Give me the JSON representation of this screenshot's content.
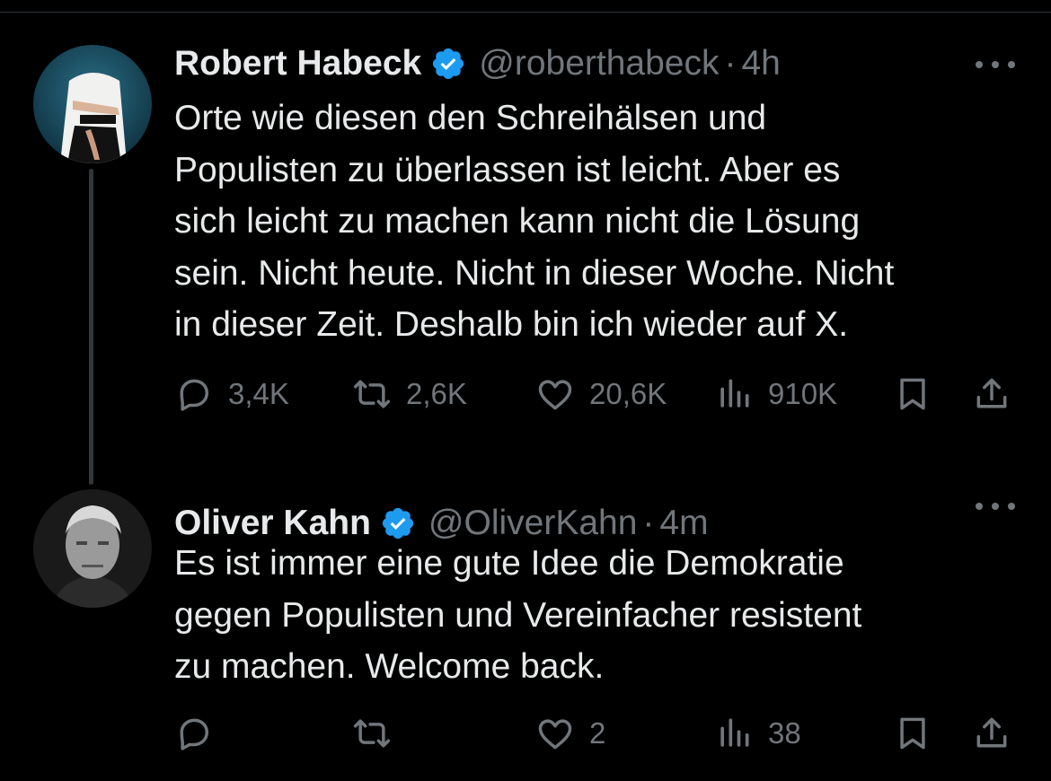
{
  "colors": {
    "background": "#000000",
    "text_primary": "#e7e9ea",
    "text_secondary": "#71767b",
    "verified_blue": "#1d9bf0",
    "thread_line": "#333639"
  },
  "tweets": [
    {
      "display_name": "Robert Habeck",
      "handle": "@roberthabeck",
      "separator": "·",
      "time": "4h",
      "verified": true,
      "text": "Orte wie diesen den Schreihälsen und\nPopulisten zu überlassen ist leicht. Aber es\nsich leicht zu machen kann nicht die Lösung\nsein. Nicht heute. Nicht in dieser Woche. Nicht\nin dieser Zeit. Deshalb bin ich wieder auf X.",
      "replies": "3,4K",
      "retweets": "2,6K",
      "likes": "20,6K",
      "views": "910K"
    },
    {
      "display_name": "Oliver Kahn",
      "handle": "@OliverKahn",
      "separator": "·",
      "time": "4m",
      "verified": true,
      "text": "Es ist immer eine gute Idee die Demokratie\ngegen Populisten und Vereinfacher resistent\nzu machen. Welcome back.",
      "replies": "",
      "retweets": "",
      "likes": "2",
      "views": "38"
    }
  ],
  "icons": {
    "verified": "verified-badge-icon",
    "more": "more-horizontal-icon",
    "reply": "reply-icon",
    "retweet": "retweet-icon",
    "like": "heart-icon",
    "views": "views-bar-chart-icon",
    "bookmark": "bookmark-icon",
    "share": "share-icon"
  }
}
